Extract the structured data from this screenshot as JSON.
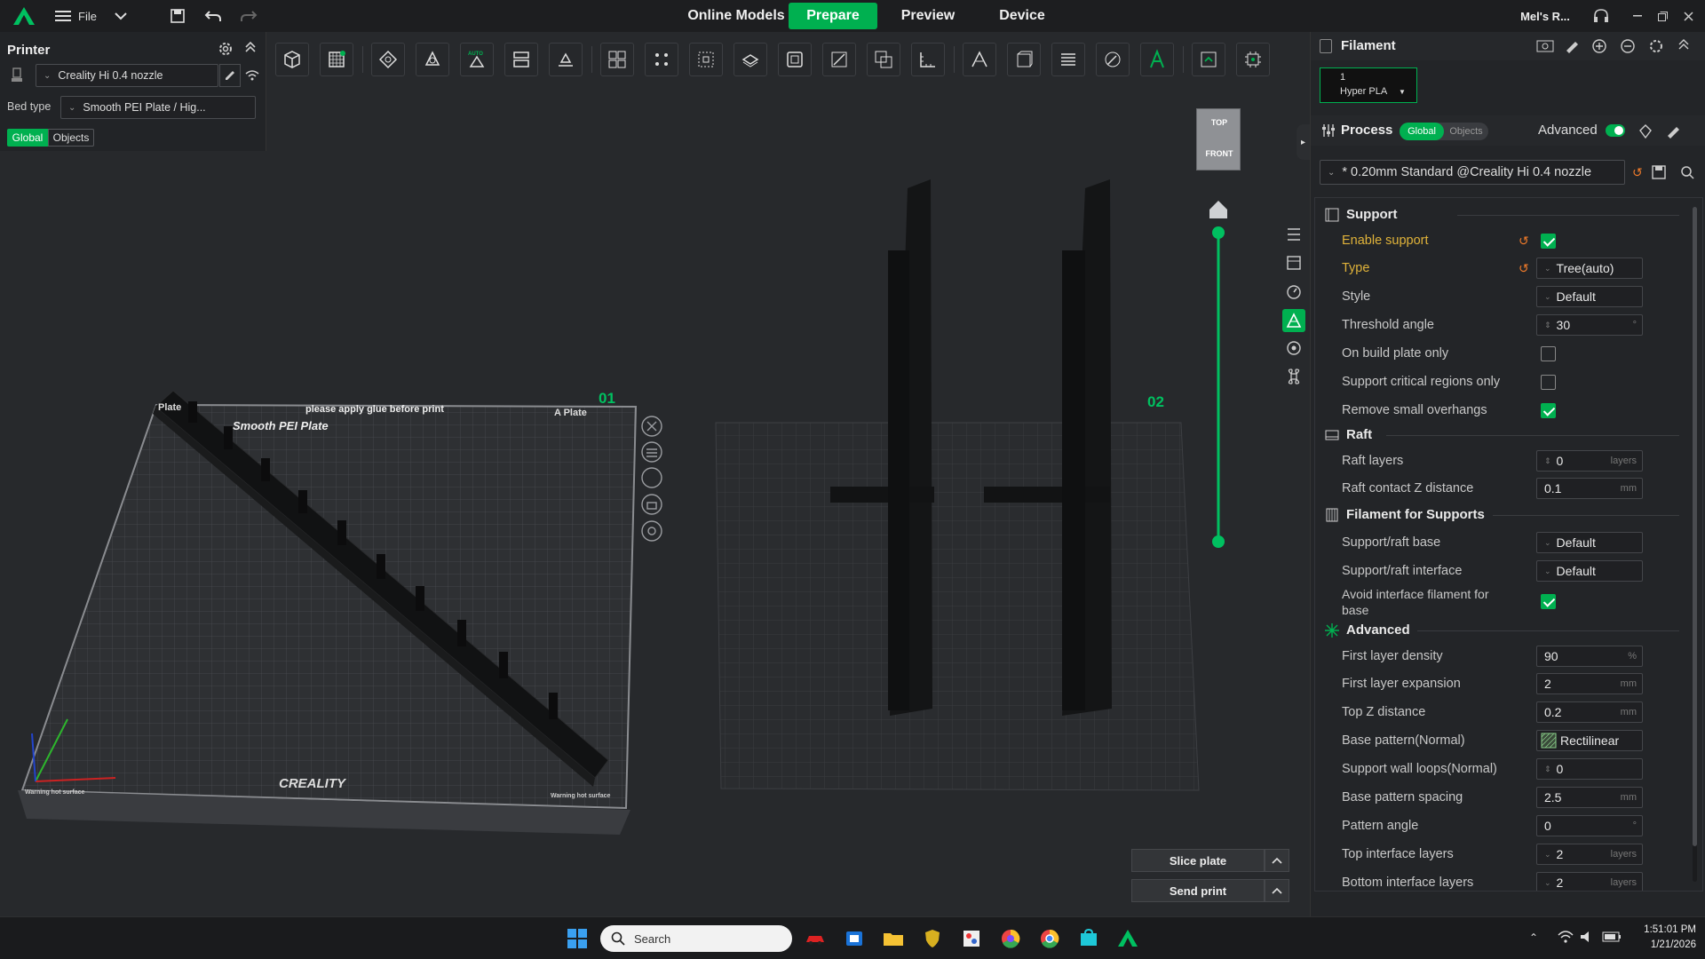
{
  "titlebar": {
    "menu_label": "File",
    "tabs": [
      "Online Models",
      "Prepare",
      "Preview",
      "Device"
    ],
    "active_tab": "Prepare",
    "account": "Mel's R..."
  },
  "printer": {
    "title": "Printer",
    "printer_name": "Creality Hi 0.4 nozzle",
    "bed_type_label": "Bed type",
    "bed_type_value": "Smooth PEI Plate / Hig...",
    "scope_global": "Global",
    "scope_objects": "Objects"
  },
  "viewport": {
    "plate1_label": "01",
    "plate2_label": "02",
    "plate1_text_top": "please apply glue before print",
    "plate1_text_a": "A Plate",
    "plate1_text_b": "Plate",
    "plate1_sheet": "Smooth PEI Plate",
    "brand": "CREALITY",
    "warning1": "Warning hot surface",
    "warning2": "Warning hot surface",
    "cube_top": "TOP",
    "cube_front": "FRONT",
    "slice_button": "Slice plate",
    "send_button": "Send print"
  },
  "filament": {
    "title": "Filament",
    "slot_number": "1",
    "slot_name": "Hyper PLA"
  },
  "process": {
    "title": "Process",
    "scope_global": "Global",
    "scope_objects": "Objects",
    "advanced_label": "Advanced",
    "preset": "* 0.20mm Standard @Creality Hi 0.4 nozzle"
  },
  "settings": {
    "support_title": "Support",
    "enable_support": "Enable support",
    "type_label": "Type",
    "type_value": "Tree(auto)",
    "style_label": "Style",
    "style_value": "Default",
    "threshold_label": "Threshold angle",
    "threshold_value": "30",
    "on_build_plate": "On build plate only",
    "critical_regions": "Support critical regions only",
    "remove_overhangs": "Remove small overhangs",
    "raft_title": "Raft",
    "raft_layers_label": "Raft layers",
    "raft_layers_value": "0",
    "raft_z_label": "Raft contact Z distance",
    "raft_z_value": "0.1",
    "filament_supports_title": "Filament for Supports",
    "raft_base_label": "Support/raft base",
    "raft_base_value": "Default",
    "raft_interface_label": "Support/raft interface",
    "raft_interface_value": "Default",
    "avoid_interface_label_1": "Avoid interface filament for",
    "avoid_interface_label_2": "base",
    "advanced_title": "Advanced",
    "first_density_label": "First layer density",
    "first_density_value": "90",
    "first_expansion_label": "First layer expansion",
    "first_expansion_value": "2",
    "top_z_label": "Top Z distance",
    "top_z_value": "0.2",
    "base_pattern_label": "Base pattern(Normal)",
    "base_pattern_value": "Rectilinear",
    "wall_loops_label": "Support wall loops(Normal)",
    "wall_loops_value": "0",
    "pattern_spacing_label": "Base pattern spacing",
    "pattern_spacing_value": "2.5",
    "pattern_angle_label": "Pattern angle",
    "pattern_angle_value": "0",
    "top_interface_label": "Top interface layers",
    "top_interface_value": "2",
    "bottom_interface_label": "Bottom interface layers",
    "bottom_interface_value": "2",
    "unit_layers": "layers",
    "unit_mm": "mm",
    "unit_pct": "%",
    "unit_deg": "°"
  },
  "taskbar": {
    "search_placeholder": "Search",
    "time": "1:51:01 PM",
    "date": "1/21/2026"
  },
  "colors": {
    "accent": "#00b050",
    "highlight_label": "#e0b33a",
    "reset_icon": "#f07b2a"
  }
}
